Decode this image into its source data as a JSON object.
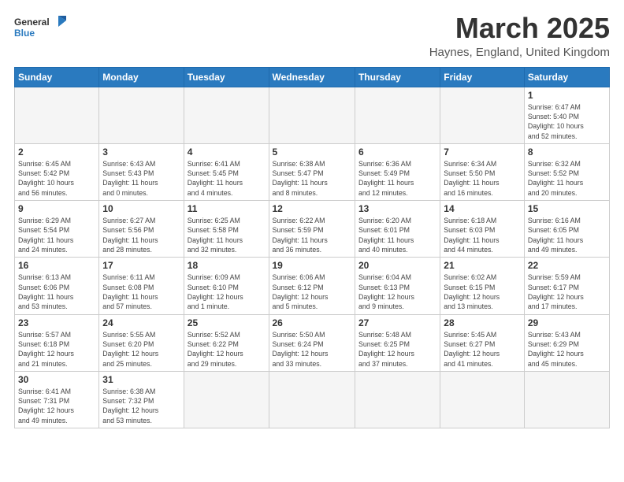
{
  "header": {
    "logo_general": "General",
    "logo_blue": "Blue",
    "month_title": "March 2025",
    "subtitle": "Haynes, England, United Kingdom"
  },
  "days_of_week": [
    "Sunday",
    "Monday",
    "Tuesday",
    "Wednesday",
    "Thursday",
    "Friday",
    "Saturday"
  ],
  "weeks": [
    [
      {
        "day": "",
        "info": ""
      },
      {
        "day": "",
        "info": ""
      },
      {
        "day": "",
        "info": ""
      },
      {
        "day": "",
        "info": ""
      },
      {
        "day": "",
        "info": ""
      },
      {
        "day": "",
        "info": ""
      },
      {
        "day": "1",
        "info": "Sunrise: 6:47 AM\nSunset: 5:40 PM\nDaylight: 10 hours\nand 52 minutes."
      }
    ],
    [
      {
        "day": "2",
        "info": "Sunrise: 6:45 AM\nSunset: 5:42 PM\nDaylight: 10 hours\nand 56 minutes."
      },
      {
        "day": "3",
        "info": "Sunrise: 6:43 AM\nSunset: 5:43 PM\nDaylight: 11 hours\nand 0 minutes."
      },
      {
        "day": "4",
        "info": "Sunrise: 6:41 AM\nSunset: 5:45 PM\nDaylight: 11 hours\nand 4 minutes."
      },
      {
        "day": "5",
        "info": "Sunrise: 6:38 AM\nSunset: 5:47 PM\nDaylight: 11 hours\nand 8 minutes."
      },
      {
        "day": "6",
        "info": "Sunrise: 6:36 AM\nSunset: 5:49 PM\nDaylight: 11 hours\nand 12 minutes."
      },
      {
        "day": "7",
        "info": "Sunrise: 6:34 AM\nSunset: 5:50 PM\nDaylight: 11 hours\nand 16 minutes."
      },
      {
        "day": "8",
        "info": "Sunrise: 6:32 AM\nSunset: 5:52 PM\nDaylight: 11 hours\nand 20 minutes."
      }
    ],
    [
      {
        "day": "9",
        "info": "Sunrise: 6:29 AM\nSunset: 5:54 PM\nDaylight: 11 hours\nand 24 minutes."
      },
      {
        "day": "10",
        "info": "Sunrise: 6:27 AM\nSunset: 5:56 PM\nDaylight: 11 hours\nand 28 minutes."
      },
      {
        "day": "11",
        "info": "Sunrise: 6:25 AM\nSunset: 5:58 PM\nDaylight: 11 hours\nand 32 minutes."
      },
      {
        "day": "12",
        "info": "Sunrise: 6:22 AM\nSunset: 5:59 PM\nDaylight: 11 hours\nand 36 minutes."
      },
      {
        "day": "13",
        "info": "Sunrise: 6:20 AM\nSunset: 6:01 PM\nDaylight: 11 hours\nand 40 minutes."
      },
      {
        "day": "14",
        "info": "Sunrise: 6:18 AM\nSunset: 6:03 PM\nDaylight: 11 hours\nand 44 minutes."
      },
      {
        "day": "15",
        "info": "Sunrise: 6:16 AM\nSunset: 6:05 PM\nDaylight: 11 hours\nand 49 minutes."
      }
    ],
    [
      {
        "day": "16",
        "info": "Sunrise: 6:13 AM\nSunset: 6:06 PM\nDaylight: 11 hours\nand 53 minutes."
      },
      {
        "day": "17",
        "info": "Sunrise: 6:11 AM\nSunset: 6:08 PM\nDaylight: 11 hours\nand 57 minutes."
      },
      {
        "day": "18",
        "info": "Sunrise: 6:09 AM\nSunset: 6:10 PM\nDaylight: 12 hours\nand 1 minute."
      },
      {
        "day": "19",
        "info": "Sunrise: 6:06 AM\nSunset: 6:12 PM\nDaylight: 12 hours\nand 5 minutes."
      },
      {
        "day": "20",
        "info": "Sunrise: 6:04 AM\nSunset: 6:13 PM\nDaylight: 12 hours\nand 9 minutes."
      },
      {
        "day": "21",
        "info": "Sunrise: 6:02 AM\nSunset: 6:15 PM\nDaylight: 12 hours\nand 13 minutes."
      },
      {
        "day": "22",
        "info": "Sunrise: 5:59 AM\nSunset: 6:17 PM\nDaylight: 12 hours\nand 17 minutes."
      }
    ],
    [
      {
        "day": "23",
        "info": "Sunrise: 5:57 AM\nSunset: 6:18 PM\nDaylight: 12 hours\nand 21 minutes."
      },
      {
        "day": "24",
        "info": "Sunrise: 5:55 AM\nSunset: 6:20 PM\nDaylight: 12 hours\nand 25 minutes."
      },
      {
        "day": "25",
        "info": "Sunrise: 5:52 AM\nSunset: 6:22 PM\nDaylight: 12 hours\nand 29 minutes."
      },
      {
        "day": "26",
        "info": "Sunrise: 5:50 AM\nSunset: 6:24 PM\nDaylight: 12 hours\nand 33 minutes."
      },
      {
        "day": "27",
        "info": "Sunrise: 5:48 AM\nSunset: 6:25 PM\nDaylight: 12 hours\nand 37 minutes."
      },
      {
        "day": "28",
        "info": "Sunrise: 5:45 AM\nSunset: 6:27 PM\nDaylight: 12 hours\nand 41 minutes."
      },
      {
        "day": "29",
        "info": "Sunrise: 5:43 AM\nSunset: 6:29 PM\nDaylight: 12 hours\nand 45 minutes."
      }
    ],
    [
      {
        "day": "30",
        "info": "Sunrise: 6:41 AM\nSunset: 7:31 PM\nDaylight: 12 hours\nand 49 minutes."
      },
      {
        "day": "31",
        "info": "Sunrise: 6:38 AM\nSunset: 7:32 PM\nDaylight: 12 hours\nand 53 minutes."
      },
      {
        "day": "",
        "info": ""
      },
      {
        "day": "",
        "info": ""
      },
      {
        "day": "",
        "info": ""
      },
      {
        "day": "",
        "info": ""
      },
      {
        "day": "",
        "info": ""
      }
    ]
  ]
}
